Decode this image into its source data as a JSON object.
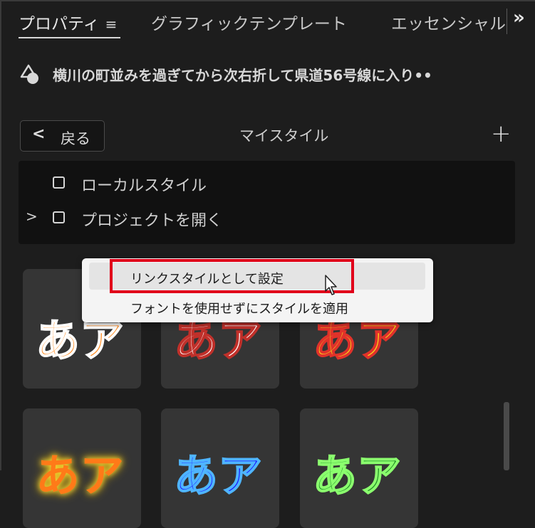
{
  "tabs": {
    "properties": "プロパティ",
    "properties_menu_icon": "≡",
    "graphic_templates": "グラフィックテンプレート",
    "essential": "エッセンシャル",
    "overflow_icon": "»"
  },
  "clip": {
    "title": "横川の町並みを過ぎてから次右折して県道56号線に入り••"
  },
  "styles": {
    "back_chevron": "<",
    "back_label": "戻る",
    "header": "マイスタイル",
    "add_icon": "+"
  },
  "folders": [
    {
      "chevron": "",
      "label": "ローカルスタイル"
    },
    {
      "chevron": ">",
      "label": "プロジェクトを開く"
    }
  ],
  "thumbnails": [
    {
      "text": "あア"
    },
    {
      "text": "あア"
    },
    {
      "text": "あア"
    },
    {
      "text": "あア"
    },
    {
      "text": "あア"
    },
    {
      "text": "あア"
    }
  ],
  "context_menu": {
    "items": [
      {
        "label": "リンクスタイルとして設定"
      },
      {
        "label": "フォントを使用せずにスタイルを適用"
      }
    ]
  },
  "colors": {
    "highlight": "#e1001a",
    "panel_bg": "#1d1d1d",
    "menu_bg": "#f4f4f4"
  }
}
